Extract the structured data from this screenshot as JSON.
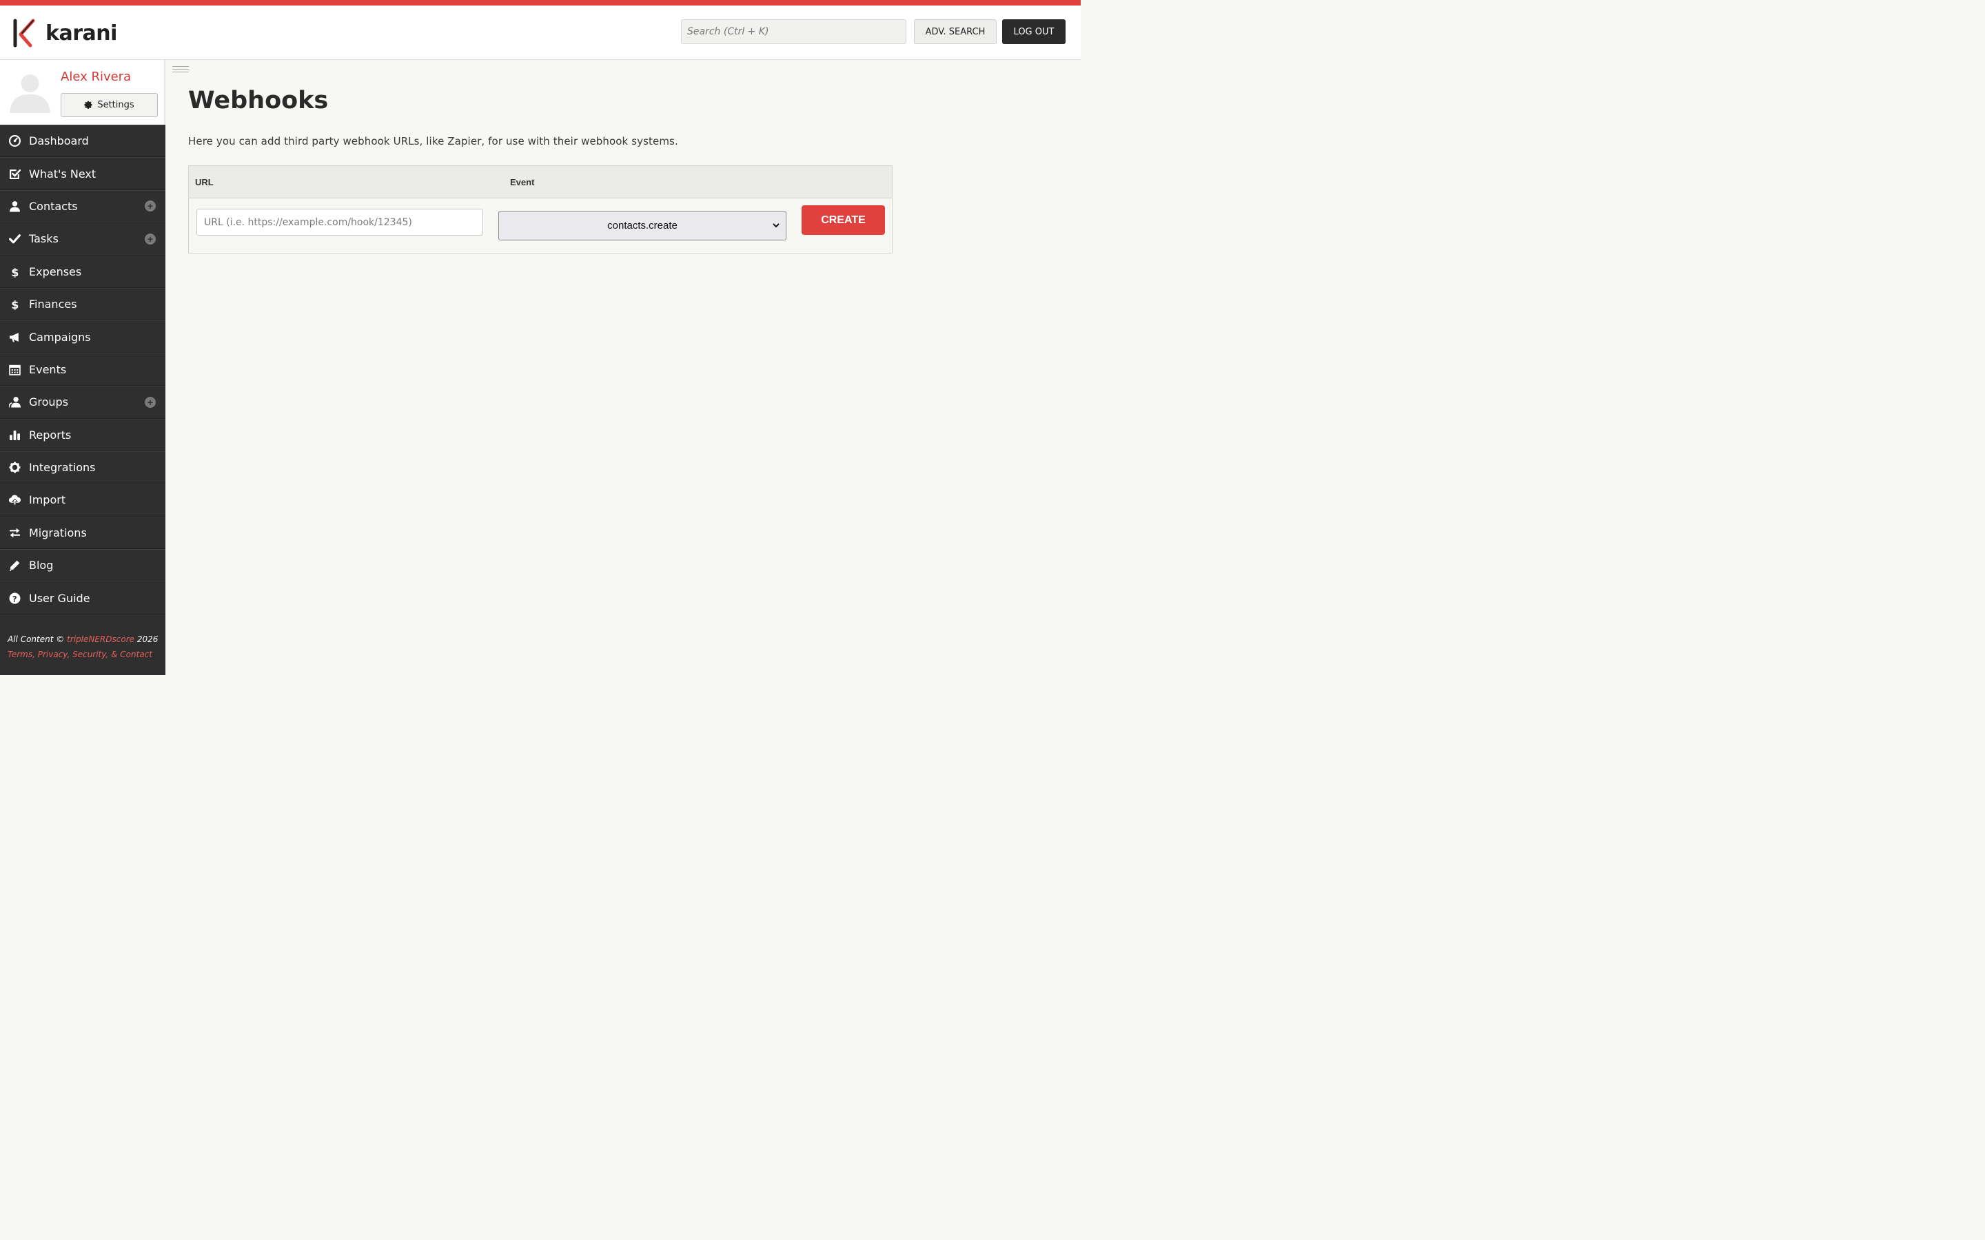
{
  "header": {
    "brand": "karani",
    "search_placeholder": "Search (Ctrl + K)",
    "adv_search_label": "ADV. SEARCH",
    "logout_label": "LOG OUT"
  },
  "colors": {
    "accent": "#e0413c",
    "sidebar_bg": "#2f2f2f",
    "header_button_dark": "#2b2b2b"
  },
  "profile": {
    "name": "Alex Rivera",
    "settings_label": "Settings"
  },
  "sidebar": {
    "items": [
      {
        "label": "Dashboard",
        "icon": "dashboard-icon",
        "plus": false
      },
      {
        "label": "What's Next",
        "icon": "check-square-icon",
        "plus": false
      },
      {
        "label": "Contacts",
        "icon": "user-icon",
        "plus": true
      },
      {
        "label": "Tasks",
        "icon": "check-icon",
        "plus": true
      },
      {
        "label": "Expenses",
        "icon": "dollar-icon",
        "plus": false
      },
      {
        "label": "Finances",
        "icon": "dollar-icon",
        "plus": false
      },
      {
        "label": "Campaigns",
        "icon": "megaphone-icon",
        "plus": false
      },
      {
        "label": "Events",
        "icon": "calendar-icon",
        "plus": false
      },
      {
        "label": "Groups",
        "icon": "users-icon",
        "plus": true
      },
      {
        "label": "Reports",
        "icon": "bar-chart-icon",
        "plus": false
      },
      {
        "label": "Integrations",
        "icon": "gear-icon",
        "plus": false
      },
      {
        "label": "Import",
        "icon": "cloud-upload-icon",
        "plus": false
      },
      {
        "label": "Migrations",
        "icon": "exchange-icon",
        "plus": false
      },
      {
        "label": "Blog",
        "icon": "pencil-icon",
        "plus": false
      },
      {
        "label": "User Guide",
        "icon": "question-icon",
        "plus": false
      }
    ]
  },
  "footer": {
    "prefix": "All Content ©",
    "company": "tripleNERDscore",
    "year": "2026",
    "links": "Terms, Privacy, Security, & Contact"
  },
  "main": {
    "title": "Webhooks",
    "description": "Here you can add third party webhook URLs, like Zapier, for use with their webhook systems.",
    "table": {
      "col_url": "URL",
      "col_event": "Event",
      "url_placeholder": "URL (i.e. https://example.com/hook/12345)",
      "event_selected": "contacts.create",
      "create_label": "CREATE"
    }
  }
}
